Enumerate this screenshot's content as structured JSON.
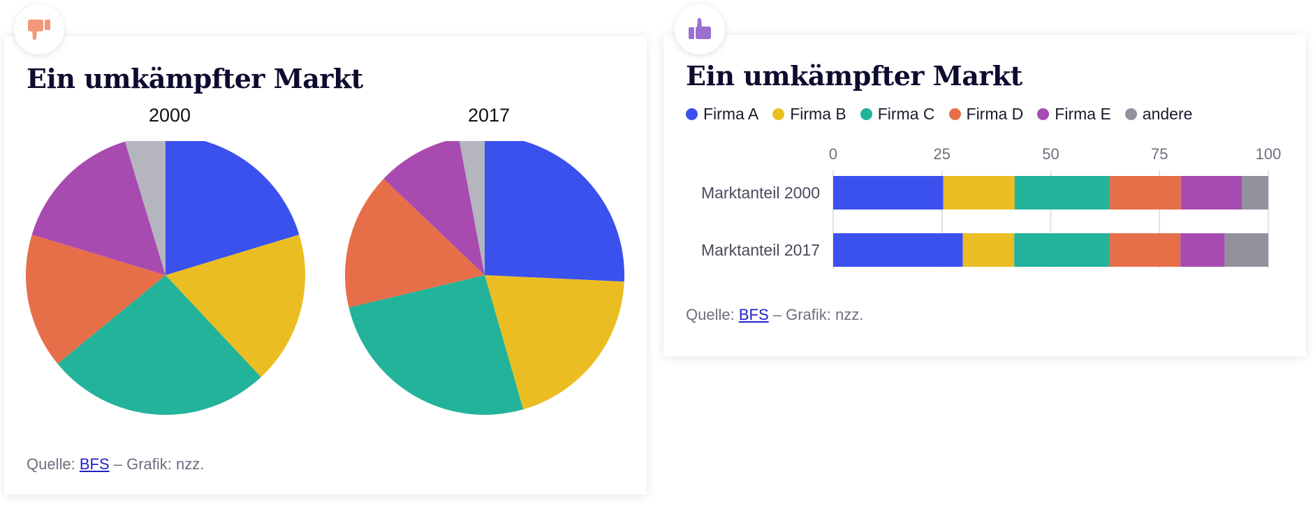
{
  "colors": {
    "Firma A": "#3b51ee",
    "Firma B": "#eabd22",
    "Firma C": "#22b39a",
    "Firma D": "#e66f4a",
    "Firma E": "#a84bb0",
    "andere": "#b5b5bf",
    "andere_bar": "#92929f",
    "badge_down": "#f2977a",
    "badge_up": "#9b6fd0"
  },
  "icons": {
    "left_badge": "thumbs-down-icon",
    "right_badge": "thumbs-up-icon"
  },
  "left": {
    "title": "Ein umkämpfter Markt",
    "source_prefix": "Quelle:",
    "source_link": "BFS",
    "source_suffix": "– Grafik: nzz."
  },
  "right": {
    "title": "Ein umkämpfter Markt",
    "source_prefix": "Quelle:",
    "source_link": "BFS",
    "source_suffix": "– Grafik: nzz."
  },
  "chart_data": [
    {
      "type": "pie",
      "title": "",
      "series": [
        {
          "name": "2000",
          "labels": [
            "Firma A",
            "Firma B",
            "Firma C",
            "Firma D",
            "Firma E",
            "andere"
          ],
          "values": [
            19.5,
            17,
            25,
            15,
            15,
            4.5
          ]
        },
        {
          "name": "2017",
          "labels": [
            "Firma A",
            "Firma B",
            "Firma C",
            "Firma D",
            "Firma E",
            "andere"
          ],
          "values": [
            26,
            20,
            26,
            16,
            10,
            3
          ]
        }
      ]
    },
    {
      "type": "bar",
      "orientation": "horizontal",
      "stacked": true,
      "categories": [
        "Marktanteil 2000",
        "Marktanteil 2017"
      ],
      "series": [
        {
          "name": "Firma A",
          "values": [
            25.3,
            29.8
          ]
        },
        {
          "name": "Firma B",
          "values": [
            16.4,
            11.8
          ]
        },
        {
          "name": "Firma C",
          "values": [
            21.8,
            21.8
          ]
        },
        {
          "name": "Firma D",
          "values": [
            16.4,
            16.4
          ]
        },
        {
          "name": "Firma E",
          "values": [
            14.0,
            10.2
          ]
        },
        {
          "name": "andere",
          "values": [
            6.1,
            10.0
          ]
        }
      ],
      "xlim": [
        0,
        100
      ],
      "ticks": [
        "0",
        "25",
        "50",
        "75",
        "100"
      ],
      "legend": "top",
      "grid": true
    }
  ]
}
